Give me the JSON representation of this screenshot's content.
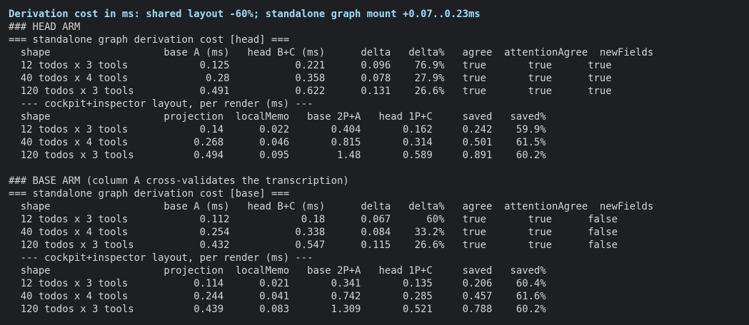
{
  "terminal": {
    "header": "Derivation cost in ms: shared layout -60%; standalone graph mount +0.07..0.23ms",
    "lines": [
      "### HEAD ARM",
      "=== standalone graph derivation cost [head] ===",
      "  shape                   base A (ms)   head B+C (ms)      delta   delta%   agree  attentionAgree  newFields",
      "  12 todos x 3 tools            0.125           0.221      0.096    76.9%   true       true      true",
      "  40 todos x 4 tools             0.28           0.358      0.078    27.9%   true       true      true",
      "  120 todos x 3 tools           0.491           0.622      0.131    26.6%   true       true      true",
      "  --- cockpit+inspector layout, per render (ms) ---",
      "  shape                   projection  localMemo   base 2P+A   head 1P+C     saved   saved%",
      "  12 todos x 3 tools            0.14      0.022       0.404       0.162     0.242    59.9%",
      "  40 todos x 4 tools           0.268      0.046       0.815       0.314     0.501    61.5%",
      "  120 todos x 3 tools          0.494      0.095        1.48       0.589     0.891    60.2%",
      "",
      "### BASE ARM (column A cross-validates the transcription)",
      "=== standalone graph derivation cost [base] ===",
      "  shape                   base A (ms)   head B+C (ms)      delta   delta%   agree  attentionAgree  newFields",
      "  12 todos x 3 tools            0.112            0.18      0.067      60%   true       true      false",
      "  40 todos x 4 tools            0.254           0.338      0.084    33.2%   true       true      false",
      "  120 todos x 3 tools           0.432           0.547      0.115    26.6%   true       true      false",
      "  --- cockpit+inspector layout, per render (ms) ---",
      "  shape                   projection  localMemo   base 2P+A   head 1P+C     saved   saved%",
      "  12 todos x 3 tools           0.114      0.021       0.341       0.135     0.206    60.4%",
      "  40 todos x 4 tools           0.244      0.041       0.742       0.285     0.457    61.6%",
      "  120 todos x 3 tools          0.439      0.083       1.309       0.521     0.788    60.2%"
    ]
  }
}
